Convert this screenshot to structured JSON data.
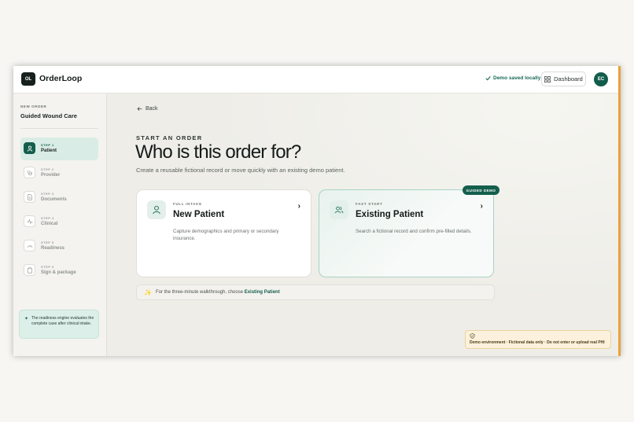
{
  "app": {
    "logo": "OL",
    "brand": "OrderLoop",
    "saved_status": "Demo saved locally",
    "dashboard_label": "Dashboard",
    "user_initials": "EC",
    "accent_color": "#145e4c"
  },
  "sidebar": {
    "kicker": "NEW ORDER",
    "title": "Guided Wound Care",
    "steps": [
      {
        "number": "STEP 1",
        "label": "Patient",
        "icon": "person-icon",
        "active": true
      },
      {
        "number": "STEP 2",
        "label": "Provider",
        "icon": "stethoscope-icon",
        "active": false
      },
      {
        "number": "STEP 3",
        "label": "Documents",
        "icon": "document-icon",
        "active": false
      },
      {
        "number": "STEP 4",
        "label": "Clinical",
        "icon": "pulse-icon",
        "active": false
      },
      {
        "number": "STEP 5",
        "label": "Readiness",
        "icon": "gauge-icon",
        "active": false
      },
      {
        "number": "STEP 6",
        "label": "Sign & package",
        "icon": "clipboard-icon",
        "active": false
      }
    ],
    "note": "The readiness engine evaluates the complete case after clinical intake."
  },
  "main": {
    "back_label": "Back",
    "kicker": "START AN ORDER",
    "headline": "Who is this order for?",
    "subline": "Create a reusable fictional record or move quickly with an existing demo patient.",
    "cards": [
      {
        "kicker": "FULL INTAKE",
        "title": "New Patient",
        "description": "Capture demographics and primary or secondary insurance.",
        "icon": "person-icon"
      },
      {
        "kicker": "FAST START",
        "title": "Existing Patient",
        "description": "Search a fictional record and confirm pre-filled details.",
        "icon": "people-icon",
        "badge": "GUIDED DEMO"
      }
    ],
    "tip_prefix": "For the three-minute walkthrough, choose",
    "tip_highlight": "Existing Patient",
    "demo_banner": "Demo environment · Fictional data only · Do not enter or upload real PHI"
  }
}
